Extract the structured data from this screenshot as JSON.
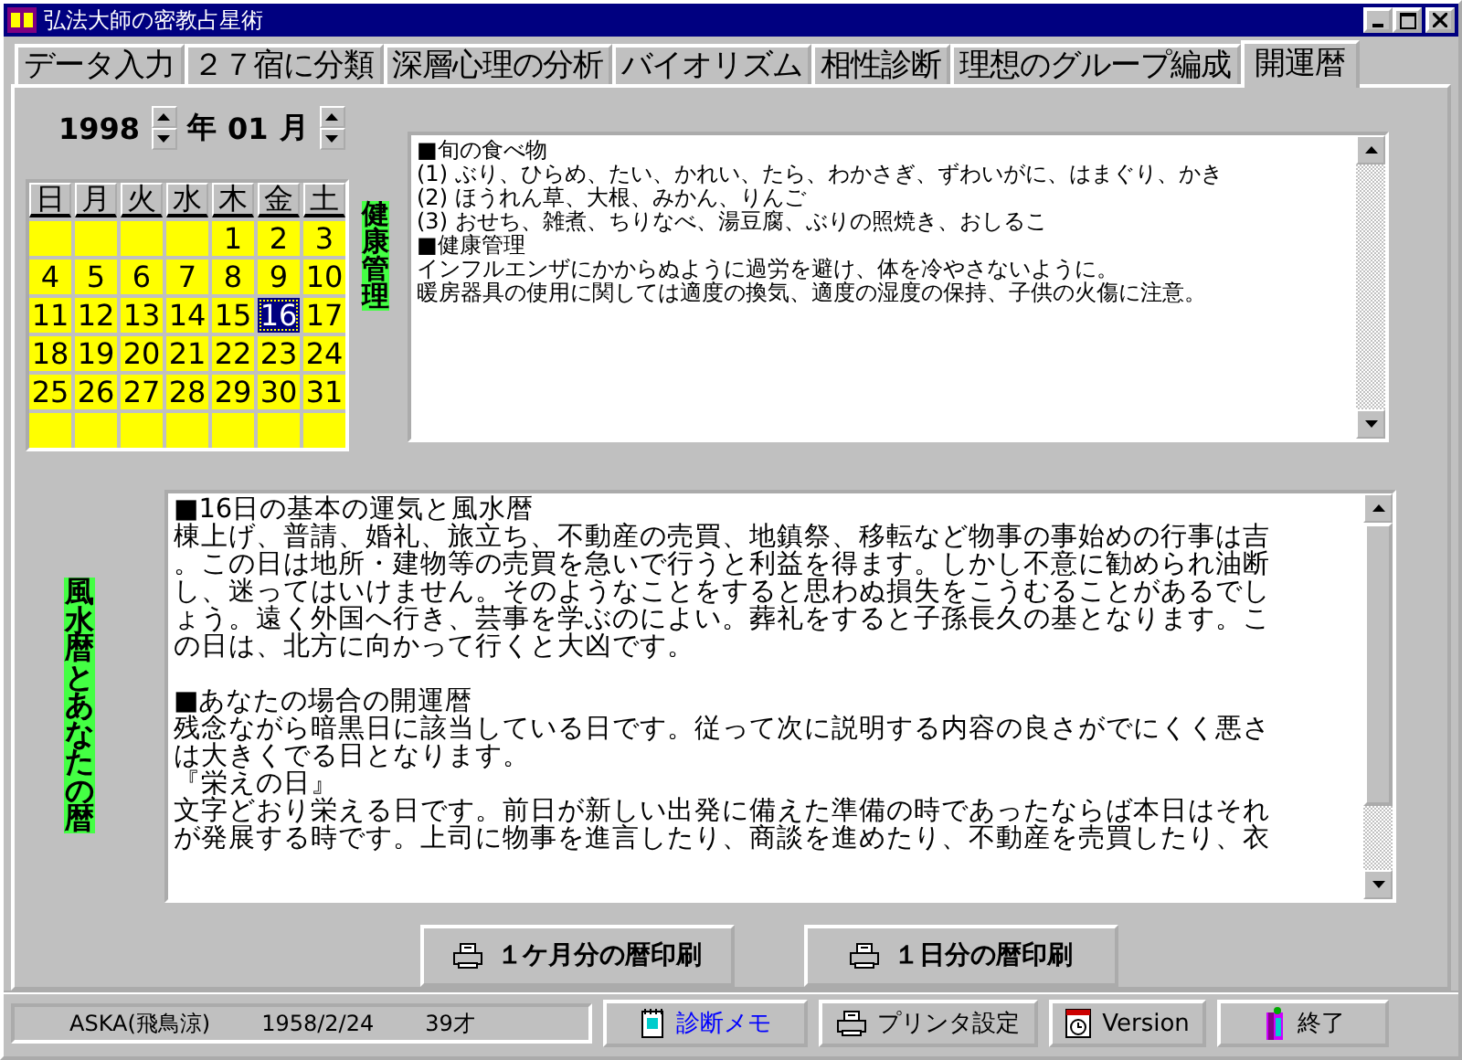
{
  "window": {
    "title": "弘法大師の密教占星術"
  },
  "tabs": [
    {
      "label": "データ入力",
      "selected": false
    },
    {
      "label": "２７宿に分類",
      "selected": false
    },
    {
      "label": "深層心理の分析",
      "selected": false
    },
    {
      "label": "バイオリズム",
      "selected": false
    },
    {
      "label": "相性診断",
      "selected": false
    },
    {
      "label": "理想のグループ編成",
      "selected": false
    },
    {
      "label": "開運暦",
      "selected": true
    }
  ],
  "date_picker": {
    "year": "1998",
    "year_unit": "年",
    "month": "01",
    "month_unit": "月"
  },
  "calendar": {
    "weekdays": [
      "日",
      "月",
      "火",
      "水",
      "木",
      "金",
      "土"
    ],
    "weeks": [
      [
        {
          "kind": "blank"
        },
        {
          "kind": "blank"
        },
        {
          "kind": "blank"
        },
        {
          "kind": "blank"
        },
        {
          "label": "1",
          "selected": false
        },
        {
          "label": "2",
          "selected": false
        },
        {
          "label": "3",
          "selected": false
        }
      ],
      [
        {
          "label": "4",
          "selected": false
        },
        {
          "label": "5",
          "selected": false
        },
        {
          "label": "6",
          "selected": false
        },
        {
          "label": "7",
          "selected": false
        },
        {
          "label": "8",
          "selected": false
        },
        {
          "label": "9",
          "selected": false
        },
        {
          "label": "10",
          "selected": false
        }
      ],
      [
        {
          "label": "11",
          "selected": false
        },
        {
          "label": "12",
          "selected": false
        },
        {
          "label": "13",
          "selected": false
        },
        {
          "label": "14",
          "selected": false
        },
        {
          "label": "15",
          "selected": false
        },
        {
          "label": "16",
          "selected": true
        },
        {
          "label": "17",
          "selected": false
        }
      ],
      [
        {
          "label": "18",
          "selected": false
        },
        {
          "label": "19",
          "selected": false
        },
        {
          "label": "20",
          "selected": false
        },
        {
          "label": "21",
          "selected": false
        },
        {
          "label": "22",
          "selected": false
        },
        {
          "label": "23",
          "selected": false
        },
        {
          "label": "24",
          "selected": false
        }
      ],
      [
        {
          "label": "25",
          "selected": false
        },
        {
          "label": "26",
          "selected": false
        },
        {
          "label": "27",
          "selected": false
        },
        {
          "label": "28",
          "selected": false
        },
        {
          "label": "29",
          "selected": false
        },
        {
          "label": "30",
          "selected": false
        },
        {
          "label": "31",
          "selected": false
        }
      ],
      [
        {
          "kind": "blank"
        },
        {
          "kind": "blank"
        },
        {
          "kind": "blank"
        },
        {
          "kind": "blank"
        },
        {
          "kind": "blank"
        },
        {
          "kind": "blank"
        },
        {
          "kind": "blank"
        }
      ]
    ]
  },
  "health_panel": {
    "label": "健康管理",
    "lines": [
      "■旬の食べ物",
      "(1) ぶり、ひらめ、たい、かれい、たら、わかさぎ、ずわいがに、はまぐり、かき",
      "(2) ほうれん草、大根、みかん、りんご",
      "(3) おせち、雑煮、ちりなべ、湯豆腐、ぶりの照焼き、おしるこ",
      "■健康管理",
      "インフルエンザにかからぬように過労を避け、体を冷やさないように。",
      "暖房器具の使用に関しては適度の換気、適度の湿度の保持、子供の火傷に注意。"
    ]
  },
  "fortune_panel": {
    "label": "風水暦とあなたの暦",
    "paragraphs": [
      {
        "lines": [
          "■16日の基本の運気と風水暦",
          "棟上げ、普請、婚礼、旅立ち、不動産の売買、地鎮祭、移転など物事の事始めの行事は吉",
          "。この日は地所・建物等の売買を急いで行うと利益を得ます。しかし不意に勧められ油断",
          "し、迷ってはいけません。そのようなことをすると思わぬ損失をこうむることがあるでし",
          "ょう。遠く外国へ行き、芸事を学ぶのによい。葬礼をすると子孫長久の基となります。こ",
          "の日は、北方に向かって行くと大凶です。"
        ]
      },
      {
        "lines": [
          "■あなたの場合の開運暦",
          "残念ながら暗黒日に該当している日です。従って次に説明する内容の良さがでにくく悪さ",
          "は大きくでる日となります。",
          "『栄えの日』",
          "文字どおり栄える日です。前日が新しい出発に備えた準備の時であったならば本日はそれ",
          "が発展する時です。上司に物事を進言したり、商談を進めたり、不動産を売買したり、衣"
        ]
      }
    ]
  },
  "print_buttons": [
    {
      "label": "１ケ月分の暦印刷"
    },
    {
      "label": "１日分の暦印刷"
    }
  ],
  "status_bar": {
    "name": "ASKA(飛鳥涼)",
    "birth_date": "1958/2/24",
    "age": "39才"
  },
  "buttons": [
    {
      "label": "診断メモ",
      "kind": "memo"
    },
    {
      "label": "プリンタ設定",
      "kind": "printer"
    },
    {
      "label": "Version",
      "kind": "version"
    },
    {
      "label": "終了",
      "kind": "exit"
    }
  ]
}
